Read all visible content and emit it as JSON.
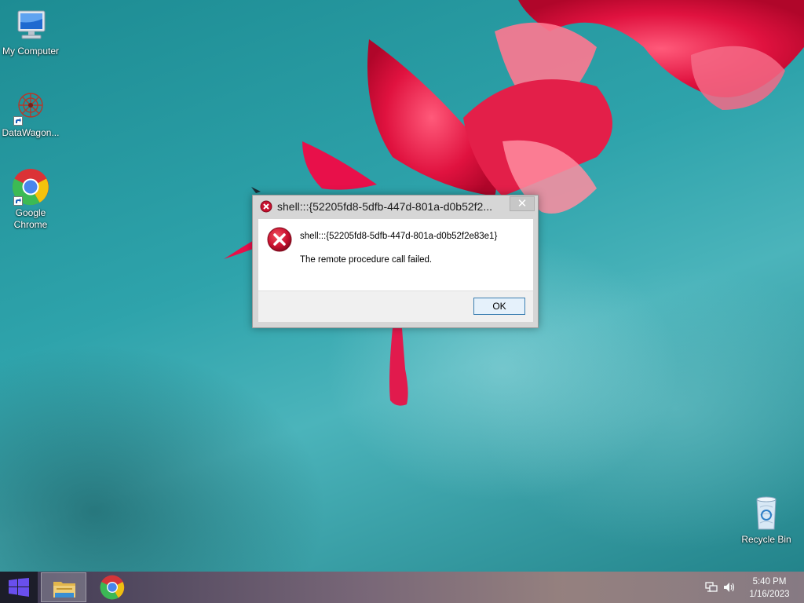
{
  "desktop": {
    "icons": [
      {
        "label": "My Computer",
        "icon": "computer-icon"
      },
      {
        "label": "DataWagon...",
        "icon": "datawagon-icon"
      },
      {
        "label": "Google Chrome",
        "icon": "chrome-icon"
      },
      {
        "label": "Recycle Bin",
        "icon": "recycle-bin-icon"
      }
    ]
  },
  "dialog": {
    "title": "shell:::{52205fd8-5dfb-447d-801a-d0b52f2...",
    "close_label": "✕",
    "message_title": "shell:::{52205fd8-5dfb-447d-801a-d0b52f2e83e1}",
    "message_body": "The remote procedure call failed.",
    "ok_label": "OK",
    "icon": "error-icon"
  },
  "taskbar": {
    "apps": [
      {
        "name": "File Explorer",
        "icon": "file-explorer-icon",
        "active": true
      },
      {
        "name": "Google Chrome",
        "icon": "chrome-icon",
        "active": false
      }
    ],
    "tray": {
      "time": "5:40 PM",
      "date": "1/16/2023",
      "icons": [
        "network-icon",
        "volume-icon"
      ]
    }
  },
  "colors": {
    "dialog_ok_border": "#3c7fb1",
    "error_red": "#c8102e",
    "start_button": "#1c1a26"
  }
}
